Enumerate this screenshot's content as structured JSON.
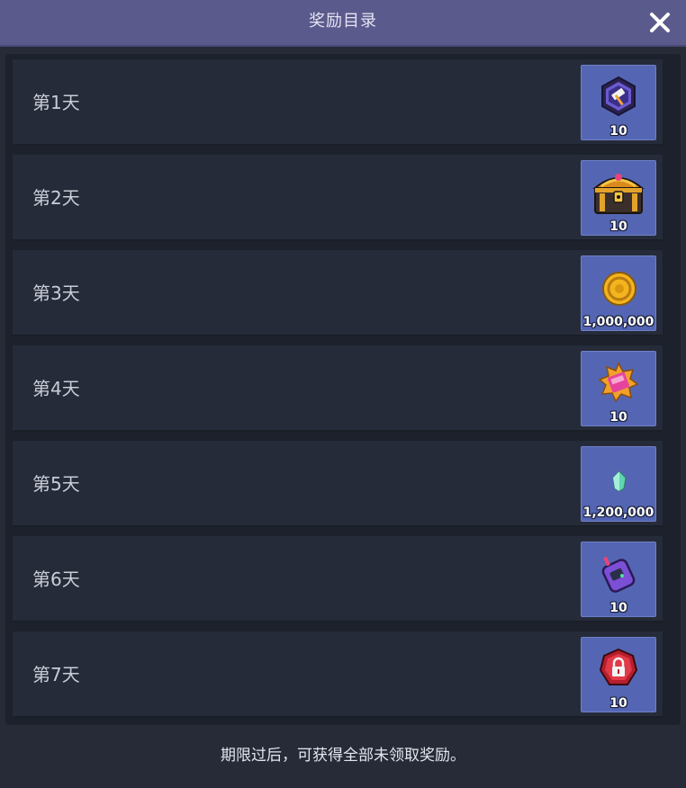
{
  "dialog": {
    "title": "奖励目录",
    "close_icon": "close-icon",
    "footer_note": "期限过后，可获得全部未领取奖励。"
  },
  "rows": [
    {
      "label": "第1天",
      "reward": {
        "icon": "hammer-emblem-icon",
        "quantity": "10"
      }
    },
    {
      "label": "第2天",
      "reward": {
        "icon": "treasure-chest-icon",
        "quantity": "10"
      }
    },
    {
      "label": "第3天",
      "reward": {
        "icon": "gold-coin-icon",
        "quantity": "1,000,000"
      }
    },
    {
      "label": "第4天",
      "reward": {
        "icon": "pink-gem-ticket-icon",
        "quantity": "10"
      }
    },
    {
      "label": "第5天",
      "reward": {
        "icon": "crystal-shard-icon",
        "quantity": "1,200,000"
      }
    },
    {
      "label": "第6天",
      "reward": {
        "icon": "purple-device-icon",
        "quantity": "10"
      }
    },
    {
      "label": "第7天",
      "reward": {
        "icon": "red-lock-emblem-icon",
        "quantity": "10"
      }
    }
  ],
  "colors": {
    "header": "#5b5a8c",
    "background": "#262b37",
    "row": "#252b38",
    "reward_box": "#5466b3"
  }
}
